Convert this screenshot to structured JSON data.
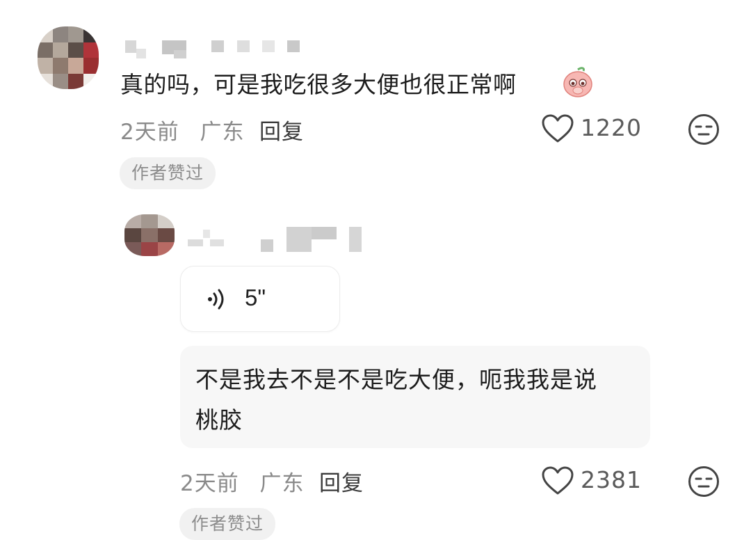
{
  "comment": {
    "text": "真的吗，可是我吃很多大便也很正常啊",
    "emoji_icon": "peach-crying-emoji",
    "time": "2天前",
    "location": "广东",
    "reply_label": "回复",
    "likes": "1220",
    "author_liked_badge": "作者赞过"
  },
  "reply_comment": {
    "voice_duration": "5\"",
    "text_line1": "不是我去不是不是吃大便，呃我我是说",
    "text_line2": "桃胶",
    "time": "2天前",
    "location": "广东",
    "reply_label": "回复",
    "likes": "2381",
    "author_liked_badge": "作者赞过"
  },
  "colors": {
    "background": "#ffffff",
    "meta_text": "#8a8a8a",
    "badge_bg": "#f1f1f1",
    "bubble_bg": "#f7f7f7"
  }
}
